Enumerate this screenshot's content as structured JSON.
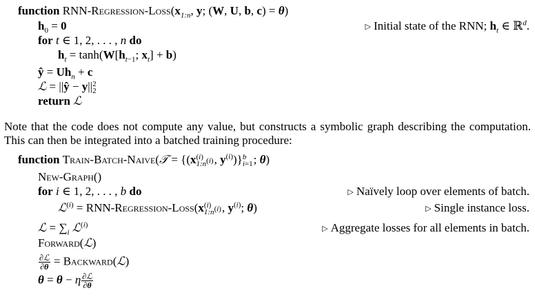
{
  "algorithm1": {
    "keyword_function": "function",
    "name": "RNN-Regression-Loss",
    "signature": "(x1:n, y; (W, U, b, c) = θ)",
    "lines": [
      "h0 = 0",
      "for t ∈ 1, 2, . . . , n do",
      "ht = tanh(W[ht−1; xt] + b)",
      "ŷ = Uhn + c",
      "L = ||ŷ − y||²₂",
      "return L"
    ],
    "comment_init": "Initial state of the RNN; ht ∈ ℝd."
  },
  "paragraph": "Note that the code does not compute any value, but constructs a symbolic graph describing the computation. This can then be integrated into a batched training procedure:",
  "algorithm2": {
    "keyword_function": "function",
    "name": "Train-Batch-Naive",
    "signature": "(T = {(x(i)1:n(i), y(i))}bi=1; θ)",
    "lines": [
      "New-Graph()",
      "for i ∈ 1, 2, . . . , b do",
      "L(i) = RNN-Regression-Loss(x(i)1:n(i), y(i); θ)",
      "L = Σi L(i)",
      "Forward(L)",
      "∂L/∂θ = Backward(L)",
      "θ = θ − η ∂L/∂θ"
    ],
    "comment_loop": "Naïvely loop over elements of batch.",
    "comment_single": "Single instance loss.",
    "comment_aggregate": "Aggregate losses for all elements in batch."
  }
}
